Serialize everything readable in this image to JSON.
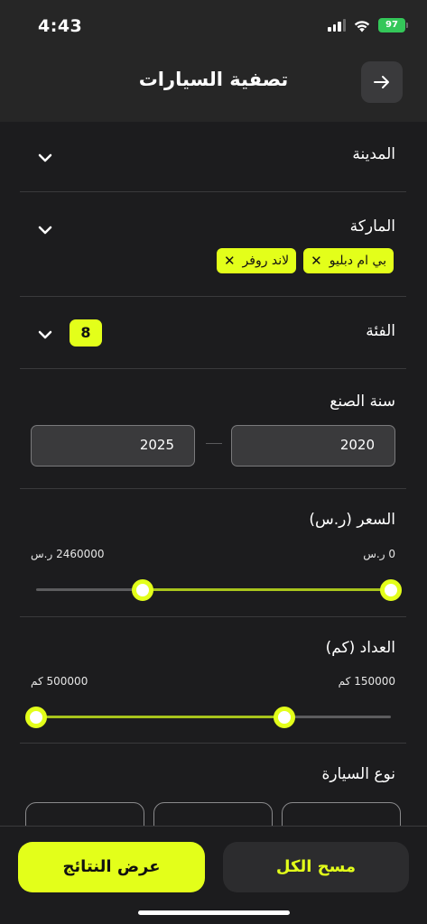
{
  "status_bar": {
    "time": "4:43",
    "battery": "97",
    "icons": [
      "cellular-signal-icon",
      "wifi-icon",
      "battery-icon"
    ]
  },
  "header": {
    "title": "تصفية السيارات",
    "back_icon": "arrow-right-icon"
  },
  "filters": {
    "city": {
      "label": "المدينة"
    },
    "brand": {
      "label": "الماركة",
      "chips": [
        "بي ام دبليو",
        "لاند روفر"
      ]
    },
    "category": {
      "label": "الفئة",
      "count": "8"
    },
    "year": {
      "label": "سنة الصنع",
      "from": "2020",
      "to": "2025"
    },
    "price": {
      "label": "السعر (ر.س)",
      "min_label": "0 ر.س",
      "max_label": "2460000 ر.س",
      "selected_from_fraction": 0.0,
      "selected_to_fraction": 0.7
    },
    "mileage": {
      "label": "العداد (كم)",
      "min_label": "150000 كم",
      "max_label": "500000 كم",
      "selected_from_fraction": 0.3,
      "selected_to_fraction": 1.0
    },
    "car_type": {
      "label": "نوع السيارة"
    }
  },
  "footer": {
    "show_results": "عرض النتائج",
    "clear_all": "مسح الكل"
  },
  "colors": {
    "accent": "#e3ff1a",
    "background": "#1c1c1e",
    "header_background": "#262626",
    "track_fill": "#a8c41c"
  }
}
